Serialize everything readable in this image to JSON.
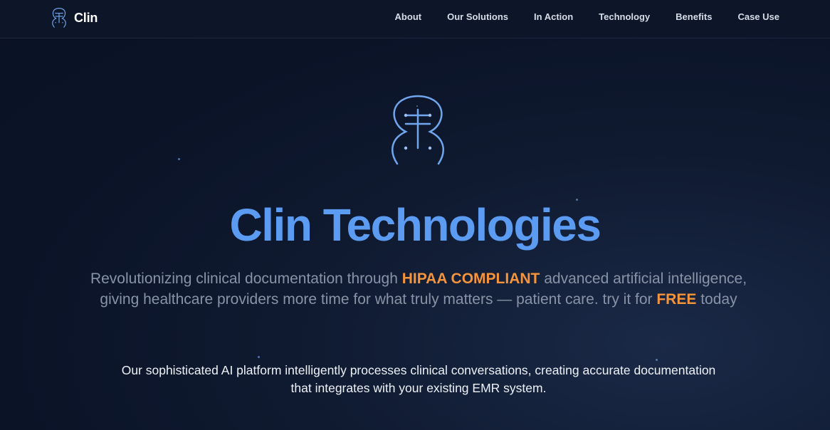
{
  "brand": {
    "name": "Clin",
    "logo_icon": "clin-logo-icon"
  },
  "nav": {
    "links": [
      "About",
      "Our Solutions",
      "In Action",
      "Technology",
      "Benefits",
      "Case Use"
    ]
  },
  "hero": {
    "logo_icon": "clin-logo-icon",
    "title": "Clin Technologies",
    "subtitle_part1": "Revolutionizing clinical documentation through ",
    "subtitle_highlight1": "HIPAA COMPLIANT",
    "subtitle_part2": " advanced artificial intelligence, giving healthcare providers more time for what truly matters — patient care. try it for ",
    "subtitle_highlight2": "FREE",
    "subtitle_part3": " today",
    "description": "Our sophisticated AI platform intelligently processes clinical conversations, creating accurate documentation that integrates with your existing EMR system."
  },
  "colors": {
    "accent_blue": "#5b9cf2",
    "accent_orange": "#f5943b",
    "background": "#0b1327"
  }
}
